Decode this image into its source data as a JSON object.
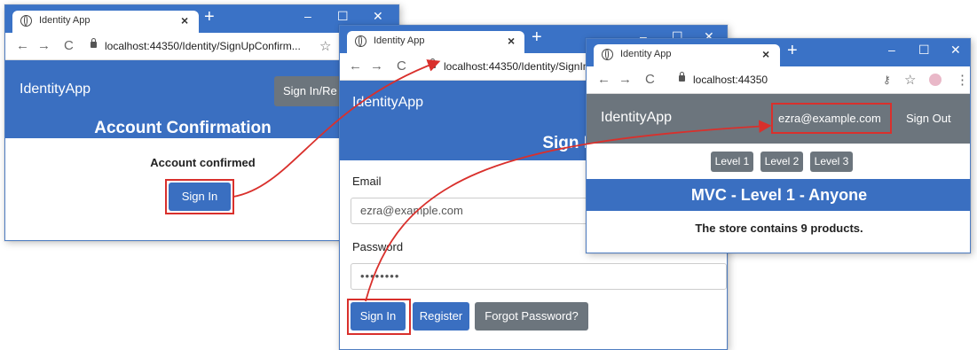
{
  "colors": {
    "accent": "#3a6fc1",
    "highlight": "#d9302c",
    "grey_button": "#6c757d"
  },
  "window1": {
    "tab_title": "Identity App",
    "url": "localhost:44350/Identity/SignUpConfirm...",
    "brand": "IdentityApp",
    "nav_button": "Sign In/Re",
    "heading": "Account Confirmation",
    "message": "Account confirmed",
    "signin_button": "Sign In"
  },
  "window2": {
    "tab_title": "Identity App",
    "url": "localhost:44350/Identity/SignIn",
    "brand": "IdentityApp",
    "heading": "Sign In",
    "email_label": "Email",
    "email_value": "ezra@example.com",
    "password_label": "Password",
    "password_value": "••••••••",
    "signin_button": "Sign In",
    "register_button": "Register",
    "forgot_button": "Forgot Password?"
  },
  "window3": {
    "tab_title": "Identity App",
    "url": "localhost:44350",
    "brand": "IdentityApp",
    "user_email": "ezra@example.com",
    "signout_button": "Sign Out",
    "levels": [
      "Level 1",
      "Level 2",
      "Level 3"
    ],
    "heading": "MVC - Level 1 - Anyone",
    "message": "The store contains 9 products."
  }
}
